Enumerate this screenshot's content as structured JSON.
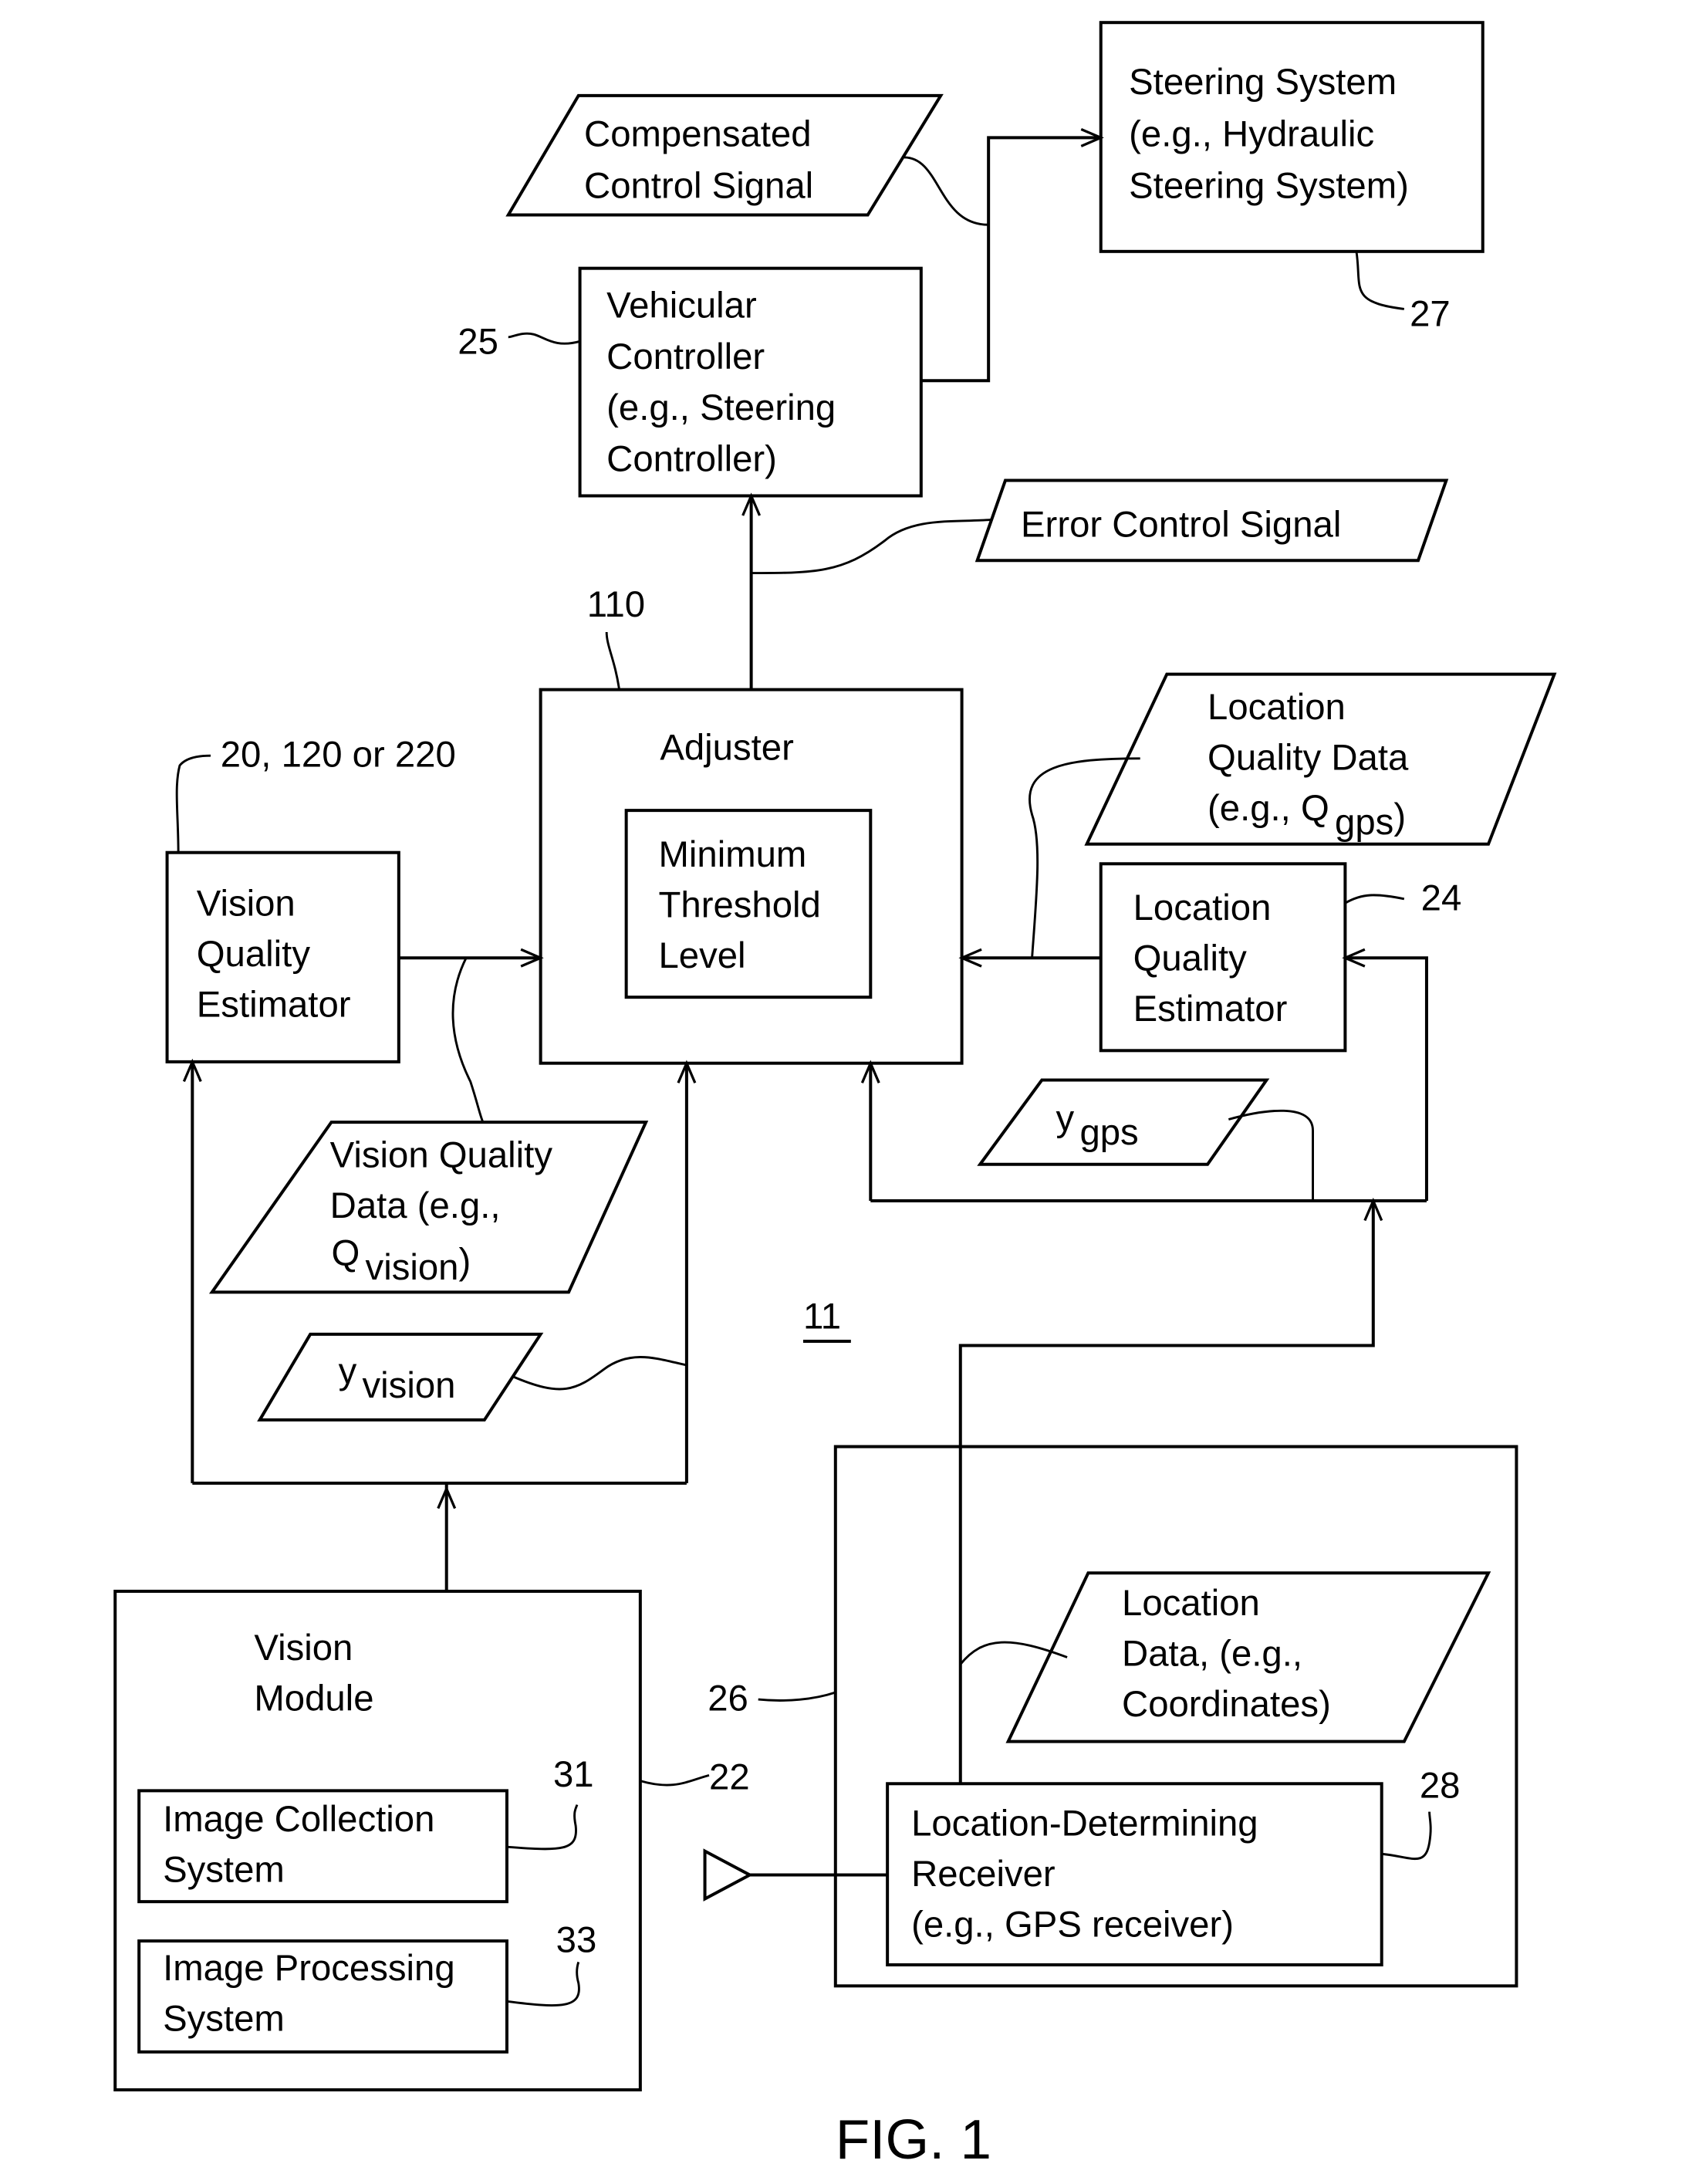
{
  "figure": {
    "title": "FIG. 1",
    "system_ref": "11"
  },
  "blocks": {
    "steering_system": {
      "lines": [
        "Steering System",
        "(e.g., Hydraulic",
        "Steering System)"
      ],
      "ref": "27"
    },
    "vehicular_controller": {
      "lines": [
        "Vehicular",
        "Controller",
        "(e.g., Steering",
        "Controller)"
      ],
      "ref": "25"
    },
    "adjuster": {
      "lines": [
        "Adjuster"
      ],
      "ref": "110"
    },
    "minimum_threshold": {
      "lines": [
        "Minimum",
        "Threshold",
        "Level"
      ]
    },
    "vision_quality_estimator": {
      "lines": [
        "Vision",
        "Quality",
        "Estimator"
      ],
      "ref": "20, 120 or 220"
    },
    "location_quality_estimator": {
      "lines": [
        "Location",
        "Quality",
        "Estimator"
      ],
      "ref": "24"
    },
    "vision_module": {
      "lines": [
        "Vision",
        "Module"
      ],
      "ref": "22"
    },
    "image_collection_system": {
      "lines": [
        "Image Collection",
        "System"
      ],
      "ref": "31"
    },
    "image_processing_system": {
      "lines": [
        "Image Processing",
        "System"
      ],
      "ref": "33"
    },
    "location_module": {
      "ref": "26"
    },
    "location_receiver": {
      "lines": [
        "Location-Determining",
        "Receiver",
        "(e.g., GPS receiver)"
      ],
      "ref": "28"
    }
  },
  "signals": {
    "compensated_control_signal": {
      "lines": [
        "Compensated",
        "Control Signal"
      ]
    },
    "error_control_signal": {
      "lines": [
        "Error Control Signal"
      ]
    },
    "location_quality_data": {
      "lines": [
        "Location",
        "Quality Data"
      ],
      "last_prefix": "(e.g., Q",
      "last_sub": "gps",
      "last_suffix": ")"
    },
    "vision_quality_data": {
      "lines": [
        "Vision Quality",
        "Data (e.g.,"
      ],
      "last_prefix": "Q",
      "last_sub": "vision",
      "last_suffix": ")"
    },
    "y_vision": {
      "base": "y",
      "sub": "vision"
    },
    "y_gps": {
      "base": "y",
      "sub": "gps"
    },
    "location_data": {
      "lines": [
        "Location",
        "Data, (e.g.,",
        "Coordinates)"
      ]
    }
  }
}
